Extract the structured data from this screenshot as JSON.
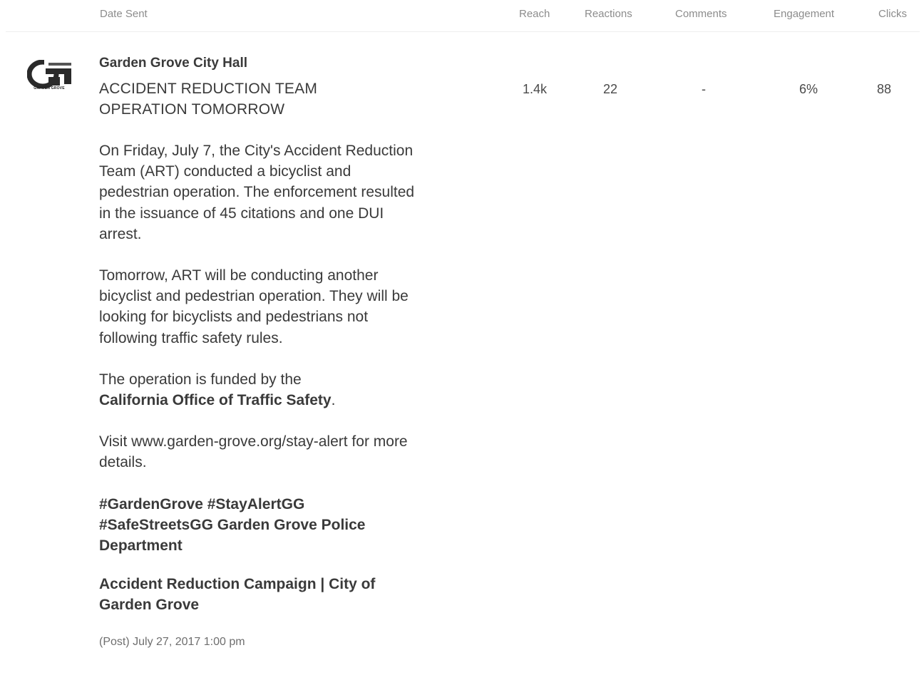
{
  "table": {
    "headers": {
      "date_sent": "Date Sent",
      "reach": "Reach",
      "reactions": "Reactions",
      "comments": "Comments",
      "engagement": "Engagement",
      "clicks": "Clicks"
    }
  },
  "post": {
    "account_name": "Garden Grove City Hall",
    "logo_letter": "G",
    "logo_caption": "GARDEN GROVE",
    "headline_line1": "ACCIDENT REDUCTION TEAM",
    "headline_line2": "OPERATION TOMORROW",
    "paragraph1": "On Friday, July 7, the City's Accident Reduction Team (ART) conducted a bicyclist and pedestrian operation. The enforcement resulted in the issuance of 45 citations and one DUI arrest.",
    "paragraph2": "Tomorrow, ART will be conducting another bicyclist and pedestrian operation. They will be looking for bicyclists and pedestrians not following traffic safety rules.",
    "paragraph3_prefix": "The operation is funded by the",
    "paragraph3_bold": "California Office of Traffic Safety",
    "paragraph3_suffix": ".",
    "paragraph4": "Visit www.garden-grove.org/stay-alert for more details.",
    "hashtags": "#GardenGrove #StayAlertGG #SafeStreetsGG Garden Grove Police Department",
    "link_title": "Accident Reduction Campaign | City of Garden Grove",
    "date_sent": "(Post) July 27, 2017 1:00 pm"
  },
  "metrics": {
    "reach": "1.4k",
    "reactions": "22",
    "comments": "-",
    "engagement": "6%",
    "clicks": "88"
  }
}
